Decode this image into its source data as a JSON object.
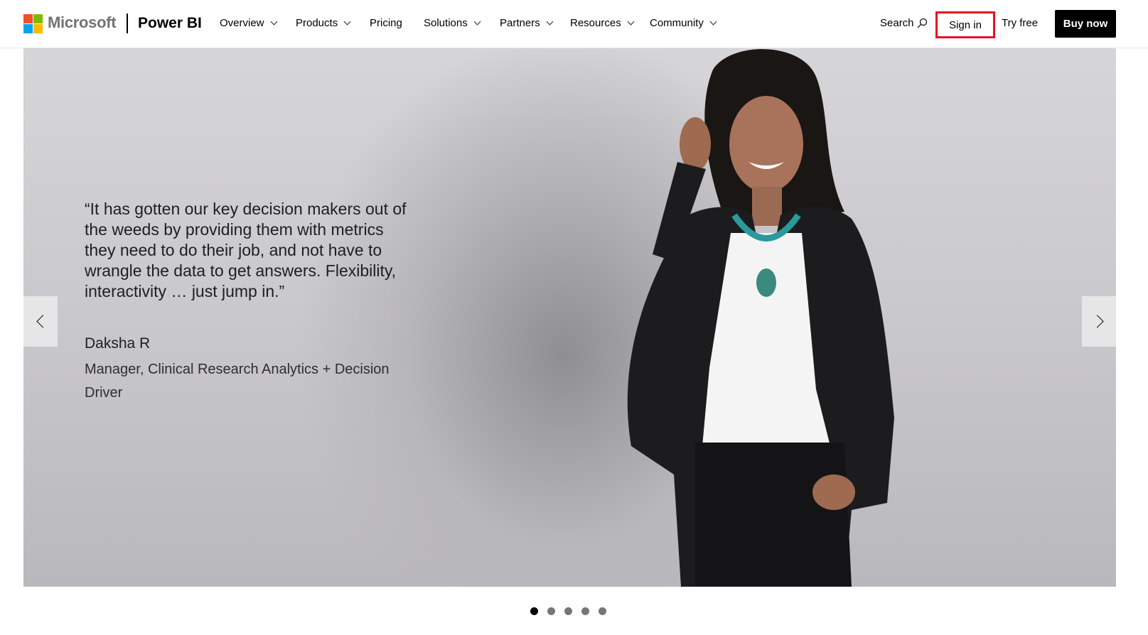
{
  "brand": {
    "company": "Microsoft",
    "product": "Power BI",
    "logo_colors": [
      "#f25022",
      "#7fba00",
      "#00a4ef",
      "#ffb900"
    ]
  },
  "nav": {
    "items": [
      {
        "label": "Overview",
        "has_dropdown": true
      },
      {
        "label": "Products",
        "has_dropdown": true
      },
      {
        "label": "Pricing",
        "has_dropdown": false
      },
      {
        "label": "Solutions",
        "has_dropdown": true
      },
      {
        "label": "Partners",
        "has_dropdown": true
      },
      {
        "label": "Resources",
        "has_dropdown": true
      },
      {
        "label": "Community",
        "has_dropdown": true
      }
    ],
    "search_label": "Search",
    "sign_in_label": "Sign in",
    "try_free_label": "Try free",
    "buy_now_label": "Buy now",
    "highlight_color": "#e81123"
  },
  "hero": {
    "quote": "“It has gotten our key decision makers out of the weeds by providing them with metrics they need to do their job, and not have to wrangle the data to get answers. Flexibility, interactivity … just jump in.”",
    "author": "Daksha R",
    "role": "Manager, Clinical Research Analytics + Decision Driver",
    "prev_icon": "chevron-left-icon",
    "next_icon": "chevron-right-icon"
  },
  "carousel": {
    "slide_count": 5,
    "active_index": 0
  }
}
